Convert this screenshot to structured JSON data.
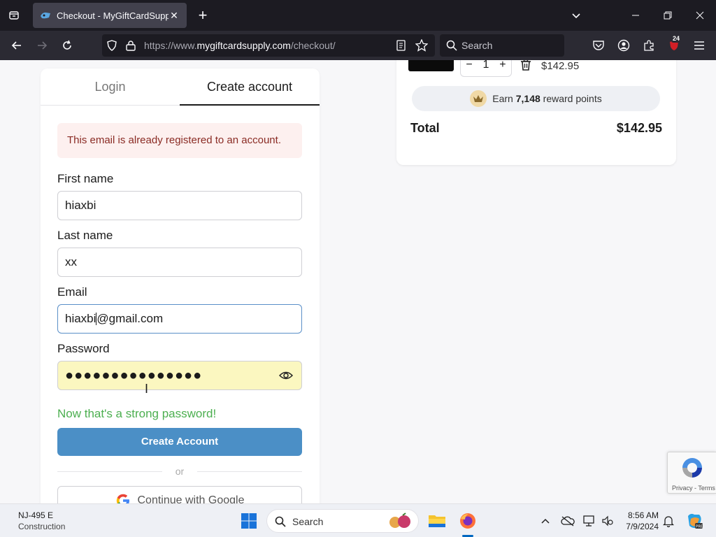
{
  "browser": {
    "tab_title": "Checkout - MyGiftCardSupply",
    "url_prefix": "https://www.",
    "url_host": "mygiftcardsupply.com",
    "url_path": "/checkout/",
    "search_placeholder": "Search",
    "extension_badge": "24"
  },
  "auth": {
    "tabs": [
      "Login",
      "Create account"
    ],
    "active_tab": "Create account",
    "alert": "This email is already registered to an account.",
    "first_name_label": "First name",
    "first_name_value": "hiaxbi",
    "last_name_label": "Last name",
    "last_name_value": "xx",
    "email_label": "Email",
    "email_value_before_caret": "hiaxbi",
    "email_value_after_caret": "@gmail.com",
    "password_label": "Password",
    "password_masked": "●●●●●●●●●●●●●●●",
    "password_strength": "Now that's a strong password!",
    "create_button": "Create Account",
    "or_text": "or",
    "google_button": "Continue with Google"
  },
  "cart": {
    "quantity": "1",
    "minus": "−",
    "plus": "+",
    "line_price": "$142.95",
    "reward_prefix": "Earn",
    "reward_points": "7,148",
    "reward_suffix": "reward points",
    "total_label": "Total",
    "total_value": "$142.95"
  },
  "recaptcha": {
    "text": "Privacy - Terms"
  },
  "taskbar": {
    "weather_title": "NJ-495 E",
    "weather_sub": "Construction",
    "search_text": "Search",
    "time": "8:56 AM",
    "date": "7/9/2024"
  },
  "colors": {
    "primary_button": "#4b8fc6",
    "strong_password": "#4caf50",
    "alert_bg": "#fdf0ef",
    "alert_text": "#8a2b24",
    "password_autofill_bg": "#fbf7c0"
  }
}
